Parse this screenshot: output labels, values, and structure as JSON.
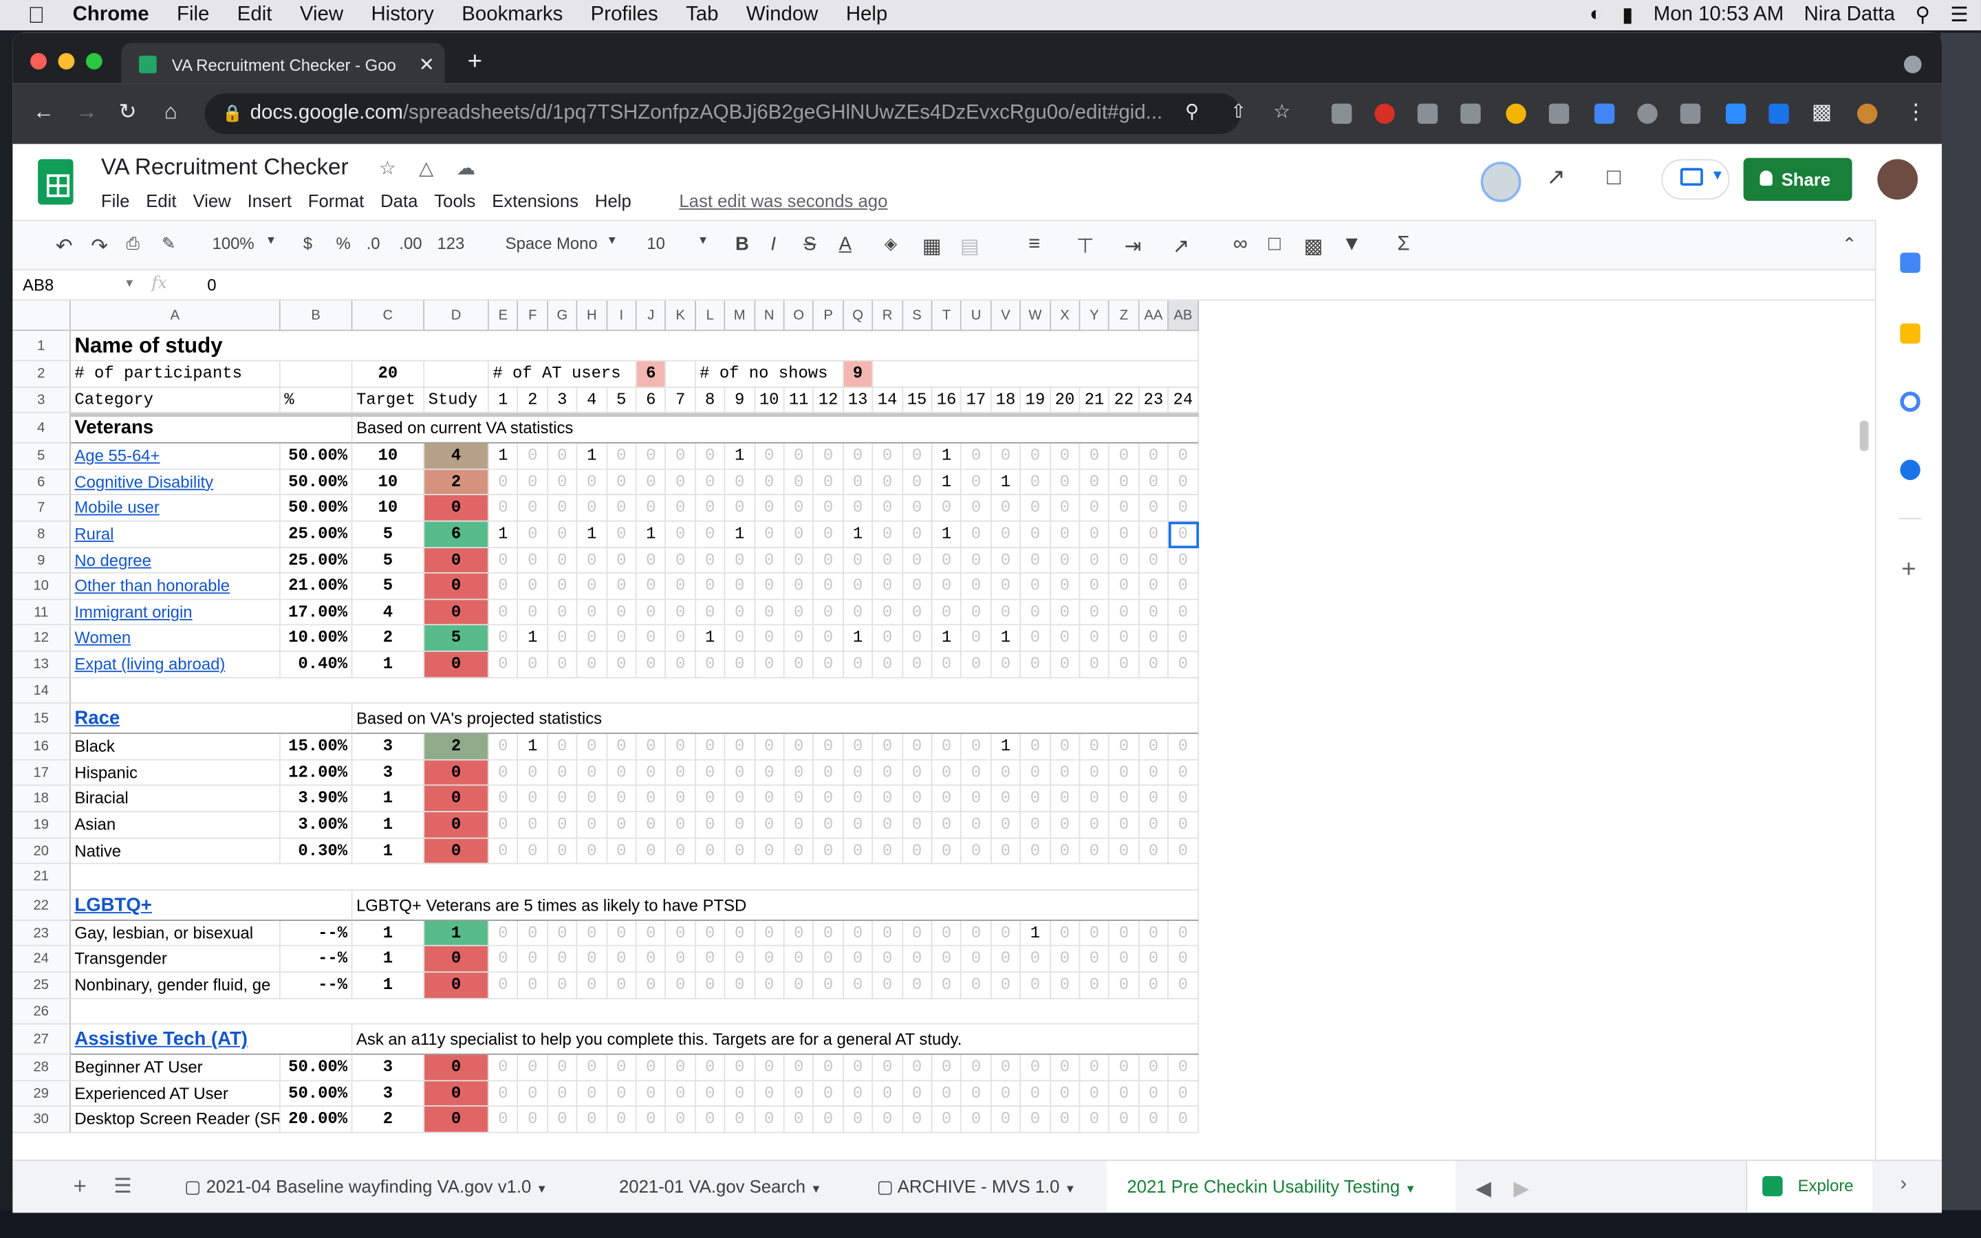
{
  "macbar": {
    "menus": [
      "Chrome",
      "File",
      "Edit",
      "View",
      "History",
      "Bookmarks",
      "Profiles",
      "Tab",
      "Window",
      "Help"
    ],
    "clock": "Mon 10:53 AM",
    "user": "Nira Datta"
  },
  "browser": {
    "tab_title": "VA Recruitment Checker - Goo",
    "url_host": "docs.google.com",
    "url_path": "/spreadsheets/d/1pq7TSHZonfpzAQBJj6B2geGHlNUwZEs4DzEvxcRgu0o/edit#gid..."
  },
  "sheets": {
    "title": "VA Recruitment Checker",
    "menus": [
      "File",
      "Edit",
      "View",
      "Insert",
      "Format",
      "Data",
      "Tools",
      "Extensions",
      "Help"
    ],
    "last_edit": "Last edit was seconds ago",
    "share": "Share",
    "zoom": "100%",
    "currency": "$",
    "percent": "%",
    "dec_less": ".0",
    "dec_more": ".00",
    "numfmt": "123",
    "font": "Space Mono",
    "size": "10",
    "namebox": "AB8",
    "formula": "0",
    "explore": "Explore",
    "sheet_tabs": [
      "2021-04 Baseline wayfinding VA.gov v1.0",
      "2021-01 VA.gov Search",
      "ARCHIVE - MVS 1.0",
      "2021 Pre Checkin Usability Testing"
    ]
  },
  "grid": {
    "columns": [
      "A",
      "B",
      "C",
      "D",
      "E",
      "F",
      "G",
      "H",
      "I",
      "J",
      "K",
      "L",
      "M",
      "N",
      "O",
      "P",
      "Q",
      "R",
      "S",
      "T",
      "U",
      "V",
      "W",
      "X",
      "Y",
      "Z",
      "AA",
      "AB"
    ],
    "rows": [
      {
        "n": "1",
        "type": "title",
        "a": "Name of study"
      },
      {
        "n": "2",
        "type": "counts",
        "a": "# of participants",
        "c": "20",
        "e_label": "# of AT users",
        "j": "6",
        "l_label": "# of no shows",
        "q": "9"
      },
      {
        "n": "3",
        "type": "header",
        "a": "Category",
        "b": "%",
        "c": "Target",
        "d": "Study",
        "participants": [
          "1",
          "2",
          "3",
          "4",
          "5",
          "6",
          "7",
          "8",
          "9",
          "10",
          "11",
          "12",
          "13",
          "14",
          "15",
          "16",
          "17",
          "18",
          "19",
          "20",
          "21",
          "22",
          "23",
          "24"
        ]
      },
      {
        "n": "4",
        "type": "section",
        "a": "Veterans",
        "note": "Based on current VA statistics"
      },
      {
        "n": "5",
        "type": "data",
        "a": "Age 55-64+",
        "link": true,
        "b": "50.00%",
        "c": "10",
        "d": "4",
        "color": "#b5a08a",
        "p": [
          1,
          0,
          0,
          1,
          0,
          0,
          0,
          0,
          1,
          0,
          0,
          0,
          0,
          0,
          0,
          1,
          0,
          0,
          0,
          0,
          0,
          0,
          0,
          0
        ]
      },
      {
        "n": "6",
        "type": "data",
        "a": "Cognitive Disability",
        "link": true,
        "b": "50.00%",
        "c": "10",
        "d": "2",
        "color": "#d4927f",
        "p": [
          0,
          0,
          0,
          0,
          0,
          0,
          0,
          0,
          0,
          0,
          0,
          0,
          0,
          0,
          0,
          1,
          0,
          1,
          0,
          0,
          0,
          0,
          0,
          0
        ]
      },
      {
        "n": "7",
        "type": "data",
        "a": "Mobile user",
        "link": true,
        "b": "50.00%",
        "c": "10",
        "d": "0",
        "color": "#e06666",
        "p": [
          0,
          0,
          0,
          0,
          0,
          0,
          0,
          0,
          0,
          0,
          0,
          0,
          0,
          0,
          0,
          0,
          0,
          0,
          0,
          0,
          0,
          0,
          0,
          0
        ]
      },
      {
        "n": "8",
        "type": "data",
        "a": "Rural",
        "link": true,
        "b": "25.00%",
        "c": "5",
        "d": "6",
        "color": "#57bb8a",
        "p": [
          1,
          0,
          0,
          1,
          0,
          1,
          0,
          0,
          1,
          0,
          0,
          0,
          1,
          0,
          0,
          1,
          0,
          0,
          0,
          0,
          0,
          0,
          0,
          0
        ]
      },
      {
        "n": "9",
        "type": "data",
        "a": "No degree",
        "link": true,
        "b": "25.00%",
        "c": "5",
        "d": "0",
        "color": "#e06666",
        "p": [
          0,
          0,
          0,
          0,
          0,
          0,
          0,
          0,
          0,
          0,
          0,
          0,
          0,
          0,
          0,
          0,
          0,
          0,
          0,
          0,
          0,
          0,
          0,
          0
        ]
      },
      {
        "n": "10",
        "type": "data",
        "a": "Other than honorable",
        "link": true,
        "b": "21.00%",
        "c": "5",
        "d": "0",
        "color": "#e06666",
        "p": [
          0,
          0,
          0,
          0,
          0,
          0,
          0,
          0,
          0,
          0,
          0,
          0,
          0,
          0,
          0,
          0,
          0,
          0,
          0,
          0,
          0,
          0,
          0,
          0
        ]
      },
      {
        "n": "11",
        "type": "data",
        "a": "Immigrant origin",
        "link": true,
        "b": "17.00%",
        "c": "4",
        "d": "0",
        "color": "#e06666",
        "p": [
          0,
          0,
          0,
          0,
          0,
          0,
          0,
          0,
          0,
          0,
          0,
          0,
          0,
          0,
          0,
          0,
          0,
          0,
          0,
          0,
          0,
          0,
          0,
          0
        ]
      },
      {
        "n": "12",
        "type": "data",
        "a": "Women",
        "link": true,
        "b": "10.00%",
        "c": "2",
        "d": "5",
        "color": "#57bb8a",
        "p": [
          0,
          1,
          0,
          0,
          0,
          0,
          0,
          1,
          0,
          0,
          0,
          0,
          1,
          0,
          0,
          1,
          0,
          1,
          0,
          0,
          0,
          0,
          0,
          0
        ]
      },
      {
        "n": "13",
        "type": "data",
        "a": "Expat (living abroad)",
        "link": true,
        "b": "0.40%",
        "c": "1",
        "d": "0",
        "color": "#e06666",
        "p": [
          0,
          0,
          0,
          0,
          0,
          0,
          0,
          0,
          0,
          0,
          0,
          0,
          0,
          0,
          0,
          0,
          0,
          0,
          0,
          0,
          0,
          0,
          0,
          0
        ]
      },
      {
        "n": "14",
        "type": "empty"
      },
      {
        "n": "15",
        "type": "section",
        "a": "Race",
        "link": true,
        "note": "Based on VA's projected statistics"
      },
      {
        "n": "16",
        "type": "data",
        "a": "Black",
        "b": "15.00%",
        "c": "3",
        "d": "2",
        "color": "#8fab8a",
        "p": [
          0,
          1,
          0,
          0,
          0,
          0,
          0,
          0,
          0,
          0,
          0,
          0,
          0,
          0,
          0,
          0,
          0,
          1,
          0,
          0,
          0,
          0,
          0,
          0
        ]
      },
      {
        "n": "17",
        "type": "data",
        "a": "Hispanic",
        "b": "12.00%",
        "c": "3",
        "d": "0",
        "color": "#e06666",
        "p": [
          0,
          0,
          0,
          0,
          0,
          0,
          0,
          0,
          0,
          0,
          0,
          0,
          0,
          0,
          0,
          0,
          0,
          0,
          0,
          0,
          0,
          0,
          0,
          0
        ]
      },
      {
        "n": "18",
        "type": "data",
        "a": "Biracial",
        "b": "3.90%",
        "c": "1",
        "d": "0",
        "color": "#e06666",
        "p": [
          0,
          0,
          0,
          0,
          0,
          0,
          0,
          0,
          0,
          0,
          0,
          0,
          0,
          0,
          0,
          0,
          0,
          0,
          0,
          0,
          0,
          0,
          0,
          0
        ]
      },
      {
        "n": "19",
        "type": "data",
        "a": "Asian",
        "b": "3.00%",
        "c": "1",
        "d": "0",
        "color": "#e06666",
        "p": [
          0,
          0,
          0,
          0,
          0,
          0,
          0,
          0,
          0,
          0,
          0,
          0,
          0,
          0,
          0,
          0,
          0,
          0,
          0,
          0,
          0,
          0,
          0,
          0
        ]
      },
      {
        "n": "20",
        "type": "data",
        "a": "Native",
        "b": "0.30%",
        "c": "1",
        "d": "0",
        "color": "#e06666",
        "p": [
          0,
          0,
          0,
          0,
          0,
          0,
          0,
          0,
          0,
          0,
          0,
          0,
          0,
          0,
          0,
          0,
          0,
          0,
          0,
          0,
          0,
          0,
          0,
          0
        ]
      },
      {
        "n": "21",
        "type": "empty"
      },
      {
        "n": "22",
        "type": "section",
        "a": "LGBTQ+",
        "link": true,
        "note": "LGBTQ+ Veterans are 5 times as likely to have PTSD"
      },
      {
        "n": "23",
        "type": "data",
        "a": "Gay, lesbian, or bisexual",
        "b": "--%",
        "c": "1",
        "d": "1",
        "color": "#57bb8a",
        "p": [
          0,
          0,
          0,
          0,
          0,
          0,
          0,
          0,
          0,
          0,
          0,
          0,
          0,
          0,
          0,
          0,
          0,
          0,
          1,
          0,
          0,
          0,
          0,
          0
        ]
      },
      {
        "n": "24",
        "type": "data",
        "a": "Transgender",
        "b": "--%",
        "c": "1",
        "d": "0",
        "color": "#e06666",
        "p": [
          0,
          0,
          0,
          0,
          0,
          0,
          0,
          0,
          0,
          0,
          0,
          0,
          0,
          0,
          0,
          0,
          0,
          0,
          0,
          0,
          0,
          0,
          0,
          0
        ]
      },
      {
        "n": "25",
        "type": "data",
        "a": "Nonbinary, gender fluid, ge",
        "b": "--%",
        "c": "1",
        "d": "0",
        "color": "#e06666",
        "p": [
          0,
          0,
          0,
          0,
          0,
          0,
          0,
          0,
          0,
          0,
          0,
          0,
          0,
          0,
          0,
          0,
          0,
          0,
          0,
          0,
          0,
          0,
          0,
          0
        ]
      },
      {
        "n": "26",
        "type": "empty"
      },
      {
        "n": "27",
        "type": "section",
        "a": "Assistive Tech (AT)",
        "link": true,
        "note": "Ask an a11y specialist to help you complete this. Targets are for a general AT study."
      },
      {
        "n": "28",
        "type": "data",
        "a": "Beginner AT User",
        "b": "50.00%",
        "c": "3",
        "d": "0",
        "color": "#e06666",
        "p": [
          0,
          0,
          0,
          0,
          0,
          0,
          0,
          0,
          0,
          0,
          0,
          0,
          0,
          0,
          0,
          0,
          0,
          0,
          0,
          0,
          0,
          0,
          0,
          0
        ]
      },
      {
        "n": "29",
        "type": "data",
        "a": "Experienced AT User",
        "b": "50.00%",
        "c": "3",
        "d": "0",
        "color": "#e06666",
        "p": [
          0,
          0,
          0,
          0,
          0,
          0,
          0,
          0,
          0,
          0,
          0,
          0,
          0,
          0,
          0,
          0,
          0,
          0,
          0,
          0,
          0,
          0,
          0,
          0
        ]
      },
      {
        "n": "30",
        "type": "data",
        "a": "Desktop Screen Reader (SR",
        "b": "20.00%",
        "c": "2",
        "d": "0",
        "color": "#e06666",
        "p": [
          0,
          0,
          0,
          0,
          0,
          0,
          0,
          0,
          0,
          0,
          0,
          0,
          0,
          0,
          0,
          0,
          0,
          0,
          0,
          0,
          0,
          0,
          0,
          0
        ]
      }
    ]
  },
  "colors": {
    "count_highlight": "#f4b6b0",
    "green": "#188038",
    "link": "#1155cc"
  }
}
